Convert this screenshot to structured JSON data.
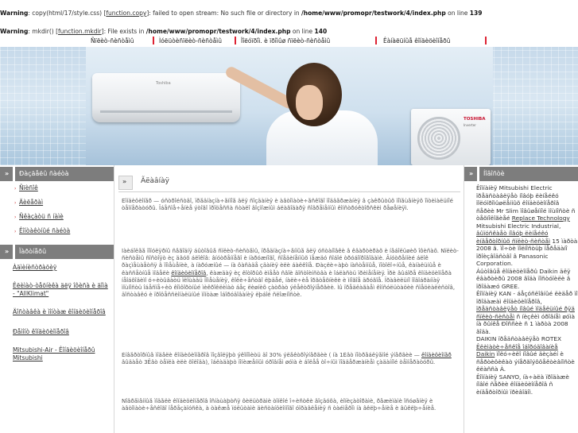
{
  "warnings": {
    "w1": {
      "label": "Warning",
      "text_a": ": copy(html/17/style.css) [",
      "fn": "function.copy",
      "text_b": "]: failed to open stream: No such file or directory in ",
      "path": "/home/www/promopr/testwork/4/index.php",
      "text_c": " on line ",
      "line": "139"
    },
    "w2": {
      "label": "Warning",
      "text_a": ": mkdir() [",
      "fn": "function.mkdir",
      "text_b": "]: File exists in ",
      "path": "/home/www/promopr/testwork/4/index.php",
      "text_c": " on line ",
      "line": "140"
    }
  },
  "topnav": {
    "items": [
      "Ñïëèò-ñèñòåìû",
      "Ìóëüòèñïëèò-ñèñòåìû",
      "Ïîëóïðîì. è ïðîìûø ñïëèò-ñèñòåìû",
      "Êàíàëüíûå êîíäèöèîíåðû"
    ],
    "sep_color": "#dd2233"
  },
  "banner": {
    "indoor_logo": "Toshiba",
    "outdoor_brand": "TOSHIBA",
    "outdoor_sub": "Inverter"
  },
  "left": {
    "menu_title": "Ðàçäåëû ñàéòà",
    "menu_items": [
      "Ñïèñîê",
      "Äèëåðàì",
      "Ñêàçàòü ñ íàìè",
      "Êîíòàêòíûé ñàéòà"
    ],
    "links_title": "Ïàðòíåðû",
    "links": [
      "Àäìèíèñòðàöèÿ",
      "Êëèìàò-òåõíèêà äëÿ îôèñà è äîìà - \"AllKlimat\"",
      "Äîñòàâêà è ìîíòàæ êîíäèöèîíåðîâ",
      "Ðåìîíò êîíäèöèîíåðîâ",
      "Mitsubishi-Air - Êîíäèöèîíåðû Mitsubishi"
    ]
  },
  "main": {
    "title": "Ãëàâíàÿ",
    "p1": "Êîíäèöèîíåð — óñòðîéñòâî, ïðåäíàçíà÷åííîå äëÿ ñîçäàíèÿ è àâòîìàòè÷åñêîãî ïîääåðæàíèÿ â çàêðûòûõ ïîìåùåíèÿõ îïòèìàëüíîé òåìïåðàòóðû. Îáåñïå÷åíèå ýòîãî ïðîöåññà ñòàëî âîçìîæíûì áëàãîäàðÿ ñîâðåìåííûì êîíñòðóêòîðñêèì ðåøåíèÿì.",
    "p2_a": "Íàèáîëåå ïîïóëÿðíû ñåãîäíÿ áûòîâûå ñïëèò-ñèñòåìû, ïðåäíàçíà÷åííûå äëÿ óñòàíîâêè â êâàðòèðàõ è íåáîëüøèõ îôèñàõ. Ñïëèò-ñèñòåìû ñîñòîÿò èç äâóõ áëîêîâ: âíóòðåííåãî è íàðóæíîãî, ñîåäèíåííûõ ìåæäó ñîáîé òðóáîïðîâîäàìè. Âíóòðåííèé áëîê ðàçìåùàåòñÿ â ïîìåùåíèè, à íàðóæíûé — íà ôàñàäå çäàíèÿ èëè áàëêîíå. Ðàçëè÷àþò íàñòåííûå, ïîòîëî÷íûå, êàíàëüíûå è êàññåòíûå ìîäåëè ",
    "p2_link": "êîíäèöèîíåðîâ",
    "p2_b": ", êàæäàÿ èç êîòîðûõ èìååò ñâîè äîñòîèíñòâà è îáëàñòü ïðèìåíåíèÿ. Ïðè âûáîðå êîíäèöèîíåðà íåîáõîäèìî ó÷èòûâàòü ïëîùàäü ïîìåùåíèÿ, êîëè÷åñòâî ëþäåé, íàëè÷èå îðãòåõíèêè è ìíîãîå äðóãîå. Ïðàâèëüíî ïîäîáðàííàÿ ìîùíîñòü îáåñïå÷èò êîìôîðòíûé ìèêðîêëèìàò áåç ëèøíèõ çàòðàò ýëåêòðîýíåðãèè. Ìû ïðåäëàãàåì êîíñóëüòàöèè ñïåöèàëèñòîâ, äîñòàâêó è ïðîôåññèîíàëüíûé ìîíòàæ îáîðóäîâàíèÿ ëþáîé ñëîæíîñòè.",
    "p3_a": "Èíâåðòîðíûå ìîäåëè êîíäèöèîíåðîâ ïîçâîëÿþò ýêîíîìèòü äî 30% ýëåêòðîýíåðãèè ( íà 1Êâò ïîòðåáëÿåìîé ýíåðãèè — ",
    "p3_link": "êîíäèöèîíåð",
    "p3_b": " âûäàåò 3Êâò òåïëà èëè õîëîäà), îáëàäàþò ïîíèæåííûì óðîâíåì øóìà è áîëåå òî÷íûì ïîääåðæàíèåì çàäàííîé òåìïåðàòóðû.",
    "p4": "Ñîâðåìåííûå ìîäåëè êîíäèöèîíåðîâ îñíàùàþòñÿ ôèëüòðàìè òîíêîé î÷èñòêè âîçäóõà, èîíèçàòîðàìè, ðåæèìàìè îñóøåíèÿ è àâòîìàòè÷åñêîãî ïåðåçàïóñêà, à òàêæå ïóëüòàìè äèñòàíöèîííîãî óïðàâëåíèÿ ñ òàéìåðîì íà âêëþ÷åíèå è âûêëþ÷åíèå."
  },
  "right": {
    "title": "Íîâîñòè",
    "n1_a": "Êîìïàíèÿ Mitsubishi Electric ïðåäñòàâëÿåò íîâóþ ëèíåéêó ïîëóïðîìûøëåííûõ êîíäèöèîíåðîâ ñåðèè Mr Slim ïîâûøåííîé ìîùíîñòè ñ òåõíîëîãèåé ",
    "n1_u": "Replace Technology",
    "n2_a": "Mitsubishi Electric Industrial, ",
    "n2_u": "âûïóñêàåò íîâóþ ëèíåéêó èíâåðòîðíûõ ñïëèò-ñèñòåì",
    "n2_b": " 15 ìàðòà 2008 ã. ïî÷òè ïîëíîñòüþ ïåðåäàíî ïðîèçâîäñòâî â Panasonic Corporation.",
    "n3_a": "Áûòîâûå êîíäèöèîíåðû Daikin äëÿ êâàðòèðû 2008 ãîäà ïîñòóïèëè â ïðîäàæó GREE.",
    "n4_a": "Êîìïàíèÿ KAN - áåçóñëîâíûé ëèäåð ïî ïðîäàæàì êîíäèöèîíåðîâ, ",
    "n4_u": "ïðåäñòàâëÿåò íîâûé ìîäåëüíûé ðÿä ñïëèò-ñèñòåì",
    "n4_b": " ñ íèçêèì óðîâíåì øóìà íà ðûíêå Ðîññèè ñ 1 ìàðòà 2008 ãîäà.",
    "n5_a": "DAIKIN ïðåäñòàâëÿåò ROTEX ",
    "n5_u": "Êëèìàòè÷åñêîå îáîðóäîâàíèå Daikin",
    "n5_b": " ïîëó÷èëî íîâûé äèçàéí è ñåðòèôèêàò ýíåðãîýôôåêòèâíîñòè êëàññà À.",
    "n6_a": "Êîìïàíèÿ SANYO, íà÷àëà ïðîäàæè íîâîé ñåðèè êîíäèöèîíåðîâ ñ èíâåðòîðíûì ïðèâîäîì."
  }
}
